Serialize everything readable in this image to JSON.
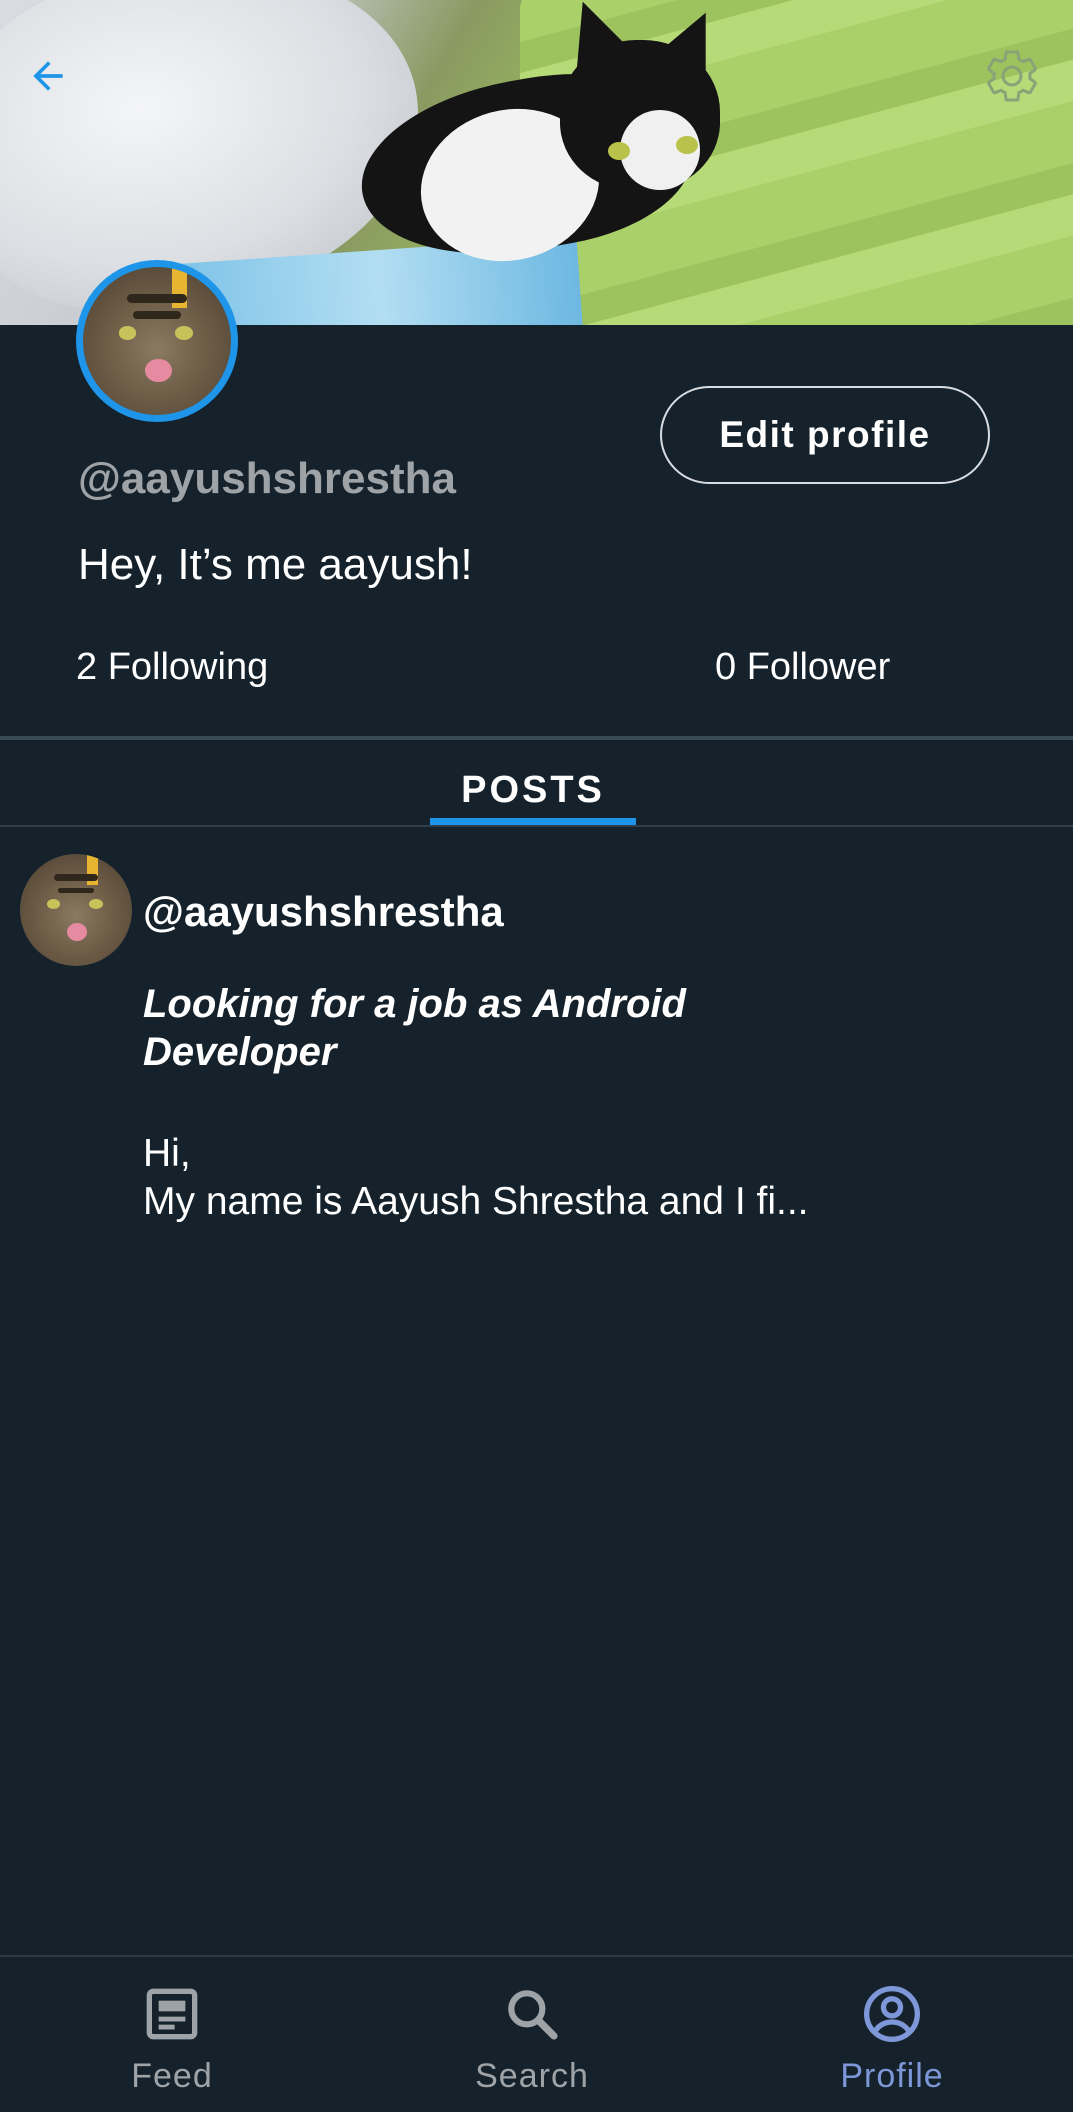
{
  "header": {
    "back_icon": "arrow-left-icon",
    "settings_icon": "gear-icon",
    "accent_color": "#1e95e8"
  },
  "profile": {
    "username": "@aayushshrestha",
    "bio": "Hey, It’s me aayush!",
    "following_label": "2 Following",
    "follower_label": "0 Follower",
    "edit_button_label": "Edit profile"
  },
  "tabs": [
    {
      "label": "POSTS",
      "active": true
    }
  ],
  "posts": [
    {
      "username": "@aayushshrestha",
      "title": "Looking for a job as Android Developer",
      "body": "Hi,\nMy name is Aayush Shrestha and I fi..."
    }
  ],
  "bottom_nav": {
    "items": [
      {
        "label": "Feed",
        "icon": "feed-icon",
        "active": false
      },
      {
        "label": "Search",
        "icon": "search-icon",
        "active": false
      },
      {
        "label": "Profile",
        "icon": "account-circle-icon",
        "active": true
      }
    ],
    "active_color": "#7d97d8",
    "inactive_color": "#9ea3a8"
  }
}
